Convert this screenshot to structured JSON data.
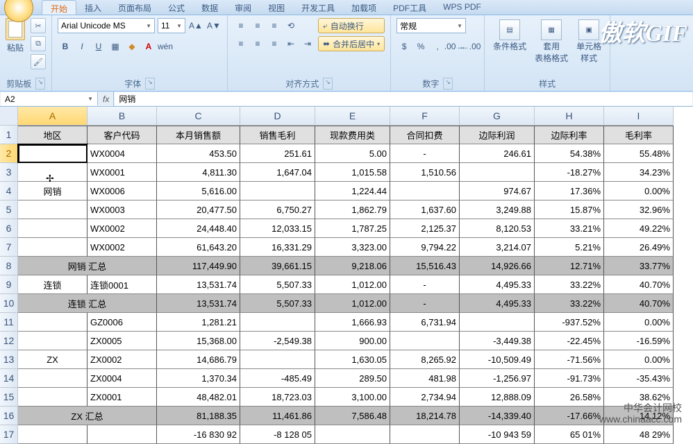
{
  "watermark_gif": "傲软GIF",
  "watermark_site": {
    "l1": "中华会计网校",
    "l2": "www.chinaacc.com"
  },
  "tabs": [
    "开始",
    "插入",
    "页面布局",
    "公式",
    "数据",
    "审阅",
    "视图",
    "开发工具",
    "加载项",
    "PDF工具",
    "WPS PDF"
  ],
  "clipboard": {
    "paste": "粘贴",
    "group": "剪贴板"
  },
  "font": {
    "name": "Arial Unicode MS",
    "size": "11",
    "group": "字体"
  },
  "align": {
    "wrap": "自动换行",
    "merge": "合并后居中",
    "group": "对齐方式"
  },
  "number": {
    "format": "常规",
    "group": "数字"
  },
  "styles": {
    "cond": "条件格式",
    "table": "套用\n表格格式",
    "cell": "单元格\n样式",
    "group": "样式"
  },
  "namebox": "A2",
  "formula": "网销",
  "cols": [
    "A",
    "B",
    "C",
    "D",
    "E",
    "F",
    "G",
    "H",
    "I"
  ],
  "headers": [
    "地区",
    "客户代码",
    "本月销售额",
    "销售毛利",
    "现款费用类",
    "合同扣费",
    "边际利润",
    "边际利率",
    "毛利率"
  ],
  "rows": [
    {
      "n": 2,
      "a": "",
      "b": "WX0004",
      "c": "453.50",
      "d": "251.61",
      "e": "5.00",
      "f": "-",
      "g": "246.61",
      "h": "54.38%",
      "i": "55.48%"
    },
    {
      "n": 3,
      "a": "",
      "b": "WX0001",
      "c": "4,811.30",
      "d": "1,647.04",
      "e": "1,015.58",
      "f": "1,510.56",
      "g": "",
      "h": "-18.27%",
      "i": "34.23%"
    },
    {
      "n": 4,
      "a": "网销",
      "b": "WX0006",
      "c": "5,616.00",
      "d": "",
      "e": "1,224.44",
      "f": "",
      "g": "974.67",
      "h": "17.36%",
      "i": "0.00%"
    },
    {
      "n": 5,
      "a": "",
      "b": "WX0003",
      "c": "20,477.50",
      "d": "6,750.27",
      "e": "1,862.79",
      "f": "1,637.60",
      "g": "3,249.88",
      "h": "15.87%",
      "i": "32.96%"
    },
    {
      "n": 6,
      "a": "",
      "b": "WX0002",
      "c": "24,448.40",
      "d": "12,033.15",
      "e": "1,787.25",
      "f": "2,125.37",
      "g": "8,120.53",
      "h": "33.21%",
      "i": "49.22%"
    },
    {
      "n": 7,
      "a": "",
      "b": "WX0002",
      "c": "61,643.20",
      "d": "16,331.29",
      "e": "3,323.00",
      "f": "9,794.22",
      "g": "3,214.07",
      "h": "5.21%",
      "i": "26.49%"
    },
    {
      "n": 8,
      "sum": true,
      "a": "网销 汇总",
      "b": "",
      "c": "117,449.90",
      "d": "39,661.15",
      "e": "9,218.06",
      "f": "15,516.43",
      "g": "14,926.66",
      "h": "12.71%",
      "i": "33.77%"
    },
    {
      "n": 9,
      "a": "连锁",
      "b": "连锁0001",
      "c": "13,531.74",
      "d": "5,507.33",
      "e": "1,012.00",
      "f": "-",
      "g": "4,495.33",
      "h": "33.22%",
      "i": "40.70%"
    },
    {
      "n": 10,
      "sum": true,
      "a": "连锁 汇总",
      "b": "",
      "c": "13,531.74",
      "d": "5,507.33",
      "e": "1,012.00",
      "f": "-",
      "g": "4,495.33",
      "h": "33.22%",
      "i": "40.70%"
    },
    {
      "n": 11,
      "a": "",
      "b": "GZ0006",
      "c": "1,281.21",
      "d": "",
      "e": "1,666.93",
      "f": "6,731.94",
      "g": "",
      "h": "-937.52%",
      "i": "0.00%"
    },
    {
      "n": 12,
      "a": "",
      "b": "ZX0005",
      "c": "15,368.00",
      "d": "-2,549.38",
      "e": "900.00",
      "f": "",
      "g": "-3,449.38",
      "h": "-22.45%",
      "i": "-16.59%"
    },
    {
      "n": 13,
      "a": "ZX",
      "b": "ZX0002",
      "c": "14,686.79",
      "d": "",
      "e": "1,630.05",
      "f": "8,265.92",
      "g": "-10,509.49",
      "h": "-71.56%",
      "i": "0.00%"
    },
    {
      "n": 14,
      "a": "",
      "b": "ZX0004",
      "c": "1,370.34",
      "d": "-485.49",
      "e": "289.50",
      "f": "481.98",
      "g": "-1,256.97",
      "h": "-91.73%",
      "i": "-35.43%"
    },
    {
      "n": 15,
      "a": "",
      "b": "ZX0001",
      "c": "48,482.01",
      "d": "18,723.03",
      "e": "3,100.00",
      "f": "2,734.94",
      "g": "12,888.09",
      "h": "26.58%",
      "i": "38.62%"
    },
    {
      "n": 16,
      "sum": true,
      "a": "ZX 汇总",
      "b": "",
      "c": "81,188.35",
      "d": "11,461.86",
      "e": "7,586.48",
      "f": "18,214.78",
      "g": "-14,339.40",
      "h": "-17.66%",
      "i": "14.12%"
    },
    {
      "n": 17,
      "a": "",
      "b": "",
      "c": "-16 830 92",
      "d": "-8 128 05",
      "e": "",
      "f": "",
      "g": "-10 943 59",
      "h": "65 01%",
      "i": "48 29%"
    }
  ]
}
